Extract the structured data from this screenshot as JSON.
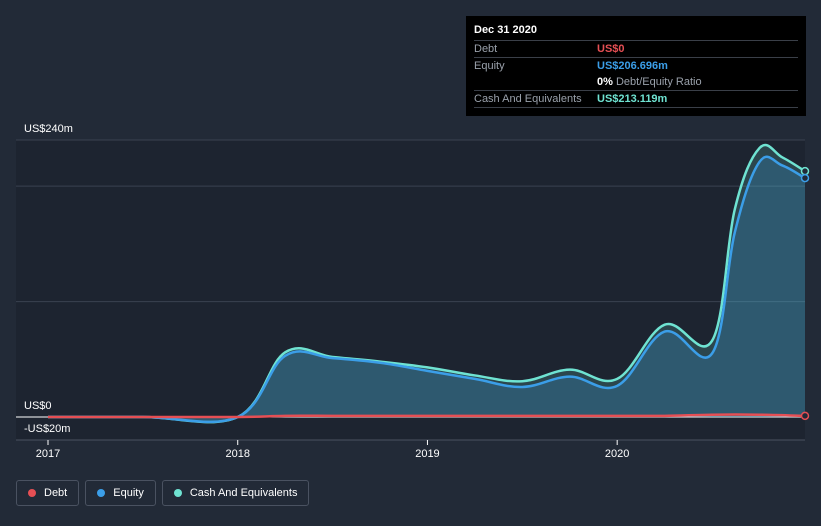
{
  "colors": {
    "background": "#222a37",
    "debt": "#e64f54",
    "equity": "#3b9ee8",
    "cash": "#6fe3d2"
  },
  "tooltip": {
    "date": "Dec 31 2020",
    "debt_label": "Debt",
    "debt_value": "US$0",
    "equity_label": "Equity",
    "equity_value": "US$206.696m",
    "ratio_value": "0%",
    "ratio_label": "Debt/Equity Ratio",
    "cash_label": "Cash And Equivalents",
    "cash_value": "US$213.119m"
  },
  "legend": {
    "debt": "Debt",
    "equity": "Equity",
    "cash": "Cash And Equivalents"
  },
  "chart_data": {
    "type": "area",
    "ylim": [
      -20,
      240
    ],
    "xlim": [
      2016.9,
      2020.99
    ],
    "y_tick_labels": [
      {
        "value": 240,
        "label": "US$240m"
      },
      {
        "value": 0,
        "label": "US$0"
      },
      {
        "value": -20,
        "label": "-US$20m"
      }
    ],
    "x_tick_labels": [
      {
        "value": 2017,
        "label": "2017"
      },
      {
        "value": 2018,
        "label": "2018"
      },
      {
        "value": 2019,
        "label": "2019"
      },
      {
        "value": 2020,
        "label": "2020"
      }
    ],
    "series": [
      {
        "name": "Cash And Equivalents",
        "color_key": "cash",
        "x": [
          2017.0,
          2017.5,
          2018.0,
          2018.25,
          2018.5,
          2018.75,
          2019.0,
          2019.25,
          2019.5,
          2019.75,
          2020.0,
          2020.25,
          2020.5,
          2020.62,
          2020.75,
          2020.87,
          2020.99
        ],
        "y": [
          0,
          0,
          0,
          56,
          52,
          48,
          43,
          36,
          31,
          41,
          33,
          80,
          66,
          180,
          233,
          225,
          213
        ]
      },
      {
        "name": "Equity",
        "color_key": "equity",
        "x": [
          2017.0,
          2017.5,
          2018.0,
          2018.25,
          2018.5,
          2018.75,
          2019.0,
          2019.25,
          2019.5,
          2019.75,
          2020.0,
          2020.25,
          2020.5,
          2020.62,
          2020.75,
          2020.87,
          2020.99
        ],
        "y": [
          0,
          0,
          0,
          53,
          51,
          47,
          40,
          33,
          26,
          35,
          27,
          74,
          55,
          160,
          221,
          218,
          207
        ]
      },
      {
        "name": "Debt",
        "color_key": "debt",
        "x": [
          2017.0,
          2017.5,
          2018.0,
          2018.25,
          2018.5,
          2018.75,
          2019.0,
          2019.25,
          2019.5,
          2019.75,
          2020.0,
          2020.25,
          2020.5,
          2020.75,
          2020.99
        ],
        "y": [
          0,
          0,
          0,
          1,
          1,
          1,
          1,
          1,
          1,
          1,
          1,
          1,
          2,
          2,
          1
        ]
      }
    ]
  }
}
